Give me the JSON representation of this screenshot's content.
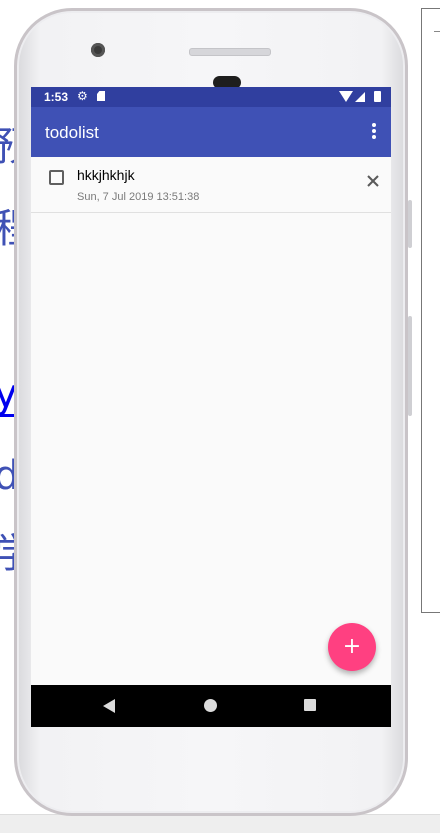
{
  "background": {
    "glyphs": [
      "预",
      "程",
      "y",
      "d",
      "学"
    ]
  },
  "status_bar": {
    "time": "1:53",
    "icons": [
      "gear-icon",
      "sd-card-icon",
      "wifi-icon",
      "cell-signal-icon",
      "battery-icon"
    ]
  },
  "app_bar": {
    "title": "todolist",
    "menu_icon": "more-vert-icon"
  },
  "todos": [
    {
      "title": "hkkjhkhjk",
      "date": "Sun, 7 Jul 2019 13:51:38",
      "checked": false
    }
  ],
  "fab": {
    "label": "+"
  },
  "nav_bar": {
    "icons": [
      "back-icon",
      "home-icon",
      "recents-icon"
    ]
  },
  "colors": {
    "primary": "#3f51b5",
    "primary_dark": "#303f9f",
    "accent": "#ff4081"
  }
}
